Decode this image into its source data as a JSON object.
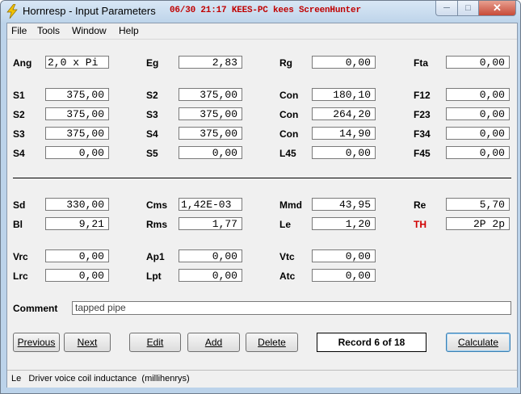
{
  "window": {
    "title": "Hornresp - Input Parameters",
    "overlay": "06/30 21:17 KEES-PC kees ScreenHunter"
  },
  "menu": [
    "File",
    "Tools",
    "Window",
    "Help"
  ],
  "params": {
    "ang": {
      "label": "Ang",
      "value": "2,0 x Pi"
    },
    "eg": {
      "label": "Eg",
      "value": "2,83"
    },
    "rg": {
      "label": "Rg",
      "value": "0,00"
    },
    "fta": {
      "label": "Fta",
      "value": "0,00"
    },
    "s1": {
      "label": "S1",
      "value": "375,00"
    },
    "s2a": {
      "label": "S2",
      "value": "375,00"
    },
    "con1": {
      "label": "Con",
      "value": "180,10"
    },
    "f12": {
      "label": "F12",
      "value": "0,00"
    },
    "s2b": {
      "label": "S2",
      "value": "375,00"
    },
    "s3a": {
      "label": "S3",
      "value": "375,00"
    },
    "con2": {
      "label": "Con",
      "value": "264,20"
    },
    "f23": {
      "label": "F23",
      "value": "0,00"
    },
    "s3b": {
      "label": "S3",
      "value": "375,00"
    },
    "s4a": {
      "label": "S4",
      "value": "375,00"
    },
    "con3": {
      "label": "Con",
      "value": "14,90"
    },
    "f34": {
      "label": "F34",
      "value": "0,00"
    },
    "s4b": {
      "label": "S4",
      "value": "0,00"
    },
    "s5": {
      "label": "S5",
      "value": "0,00"
    },
    "l45": {
      "label": "L45",
      "value": "0,00"
    },
    "f45": {
      "label": "F45",
      "value": "0,00"
    },
    "sd": {
      "label": "Sd",
      "value": "330,00"
    },
    "cms": {
      "label": "Cms",
      "value": "1,42E-03"
    },
    "mmd": {
      "label": "Mmd",
      "value": "43,95"
    },
    "re": {
      "label": "Re",
      "value": "5,70"
    },
    "bl": {
      "label": "Bl",
      "value": "9,21"
    },
    "rms": {
      "label": "Rms",
      "value": "1,77"
    },
    "le": {
      "label": "Le",
      "value": "1,20"
    },
    "th": {
      "label": "TH",
      "value": "2P 2p"
    },
    "vrc": {
      "label": "Vrc",
      "value": "0,00"
    },
    "ap1": {
      "label": "Ap1",
      "value": "0,00"
    },
    "vtc": {
      "label": "Vtc",
      "value": "0,00"
    },
    "lrc": {
      "label": "Lrc",
      "value": "0,00"
    },
    "lpt": {
      "label": "Lpt",
      "value": "0,00"
    },
    "atc": {
      "label": "Atc",
      "value": "0,00"
    }
  },
  "comment": {
    "label": "Comment",
    "value": "tapped pipe"
  },
  "buttons": {
    "previous": "Previous",
    "next": "Next",
    "edit": "Edit",
    "add": "Add",
    "delete": "Delete",
    "calculate": "Calculate"
  },
  "record": "Record 6 of 18",
  "status": "Le   Driver voice coil inductance  (millihenrys)",
  "colors": {
    "accent_red": "#d10000",
    "overlay_red": "#c00000"
  }
}
